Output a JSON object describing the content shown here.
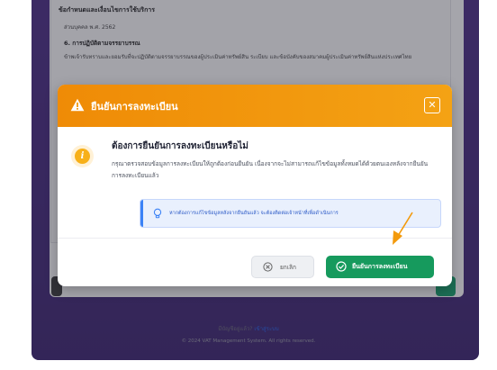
{
  "terms": {
    "heading": "ข้อกำหนดและเงื่อนไขการใช้บริการ",
    "line1": "ส่วนบุคคล พ.ศ. 2562",
    "section6_title": "6. การปฏิบัติตามจรรยาบรรณ",
    "section6_text": "ข้าพเจ้ารับทราบและยอมรับที่จะปฏิบัติตามจรรยาบรรณของผู้ประเมินค่าทรัพย์สิน ระเบียบ และข้อบังคับของสมาคมผู้ประเมินค่าทรัพย์สินแห่งประเทศไทย"
  },
  "modal": {
    "title": "ยืนยันการลงทะเบียน",
    "question": "ต้องการยืนยันการลงทะเบียนหรือไม่",
    "description": "กรุณาตรวจสอบข้อมูลการลงทะเบียนให้ถูกต้องก่อนยืนยัน เนื่องจากจะไม่สามารถแก้ไขข้อมูลทั้งหมดได้ด้วยตนเองหลังจากยืนยันการลงทะเบียนแล้ว",
    "hint": "หากต้องการแก้ไขข้อมูลหลังจากยืนยันแล้ว จะต้องติดต่อเจ้าหน้าที่เพื่อดำเนินการ",
    "cancel_label": "ยกเลิก",
    "confirm_label": "ยืนยันการลงทะเบียน",
    "close_glyph": "✕"
  },
  "footer": {
    "question": "มีบัญชีอยู่แล้ว?",
    "login_link": "เข้าสู่ระบบ",
    "copyright": "© 2024 VAT Management System. All rights reserved."
  },
  "colors": {
    "header": "#f39a0c",
    "confirm": "#169a5d",
    "hint_bg": "#e9f0fd",
    "accent_blue": "#3b82f6",
    "backdrop": "#4b2c86"
  },
  "icons": {
    "header": "warning-icon",
    "close": "close-icon",
    "info": "info-icon",
    "hint": "lightbulb-icon",
    "cancel": "x-circle-icon",
    "confirm": "check-circle-icon",
    "annotation": "arrow-pointer-icon"
  }
}
